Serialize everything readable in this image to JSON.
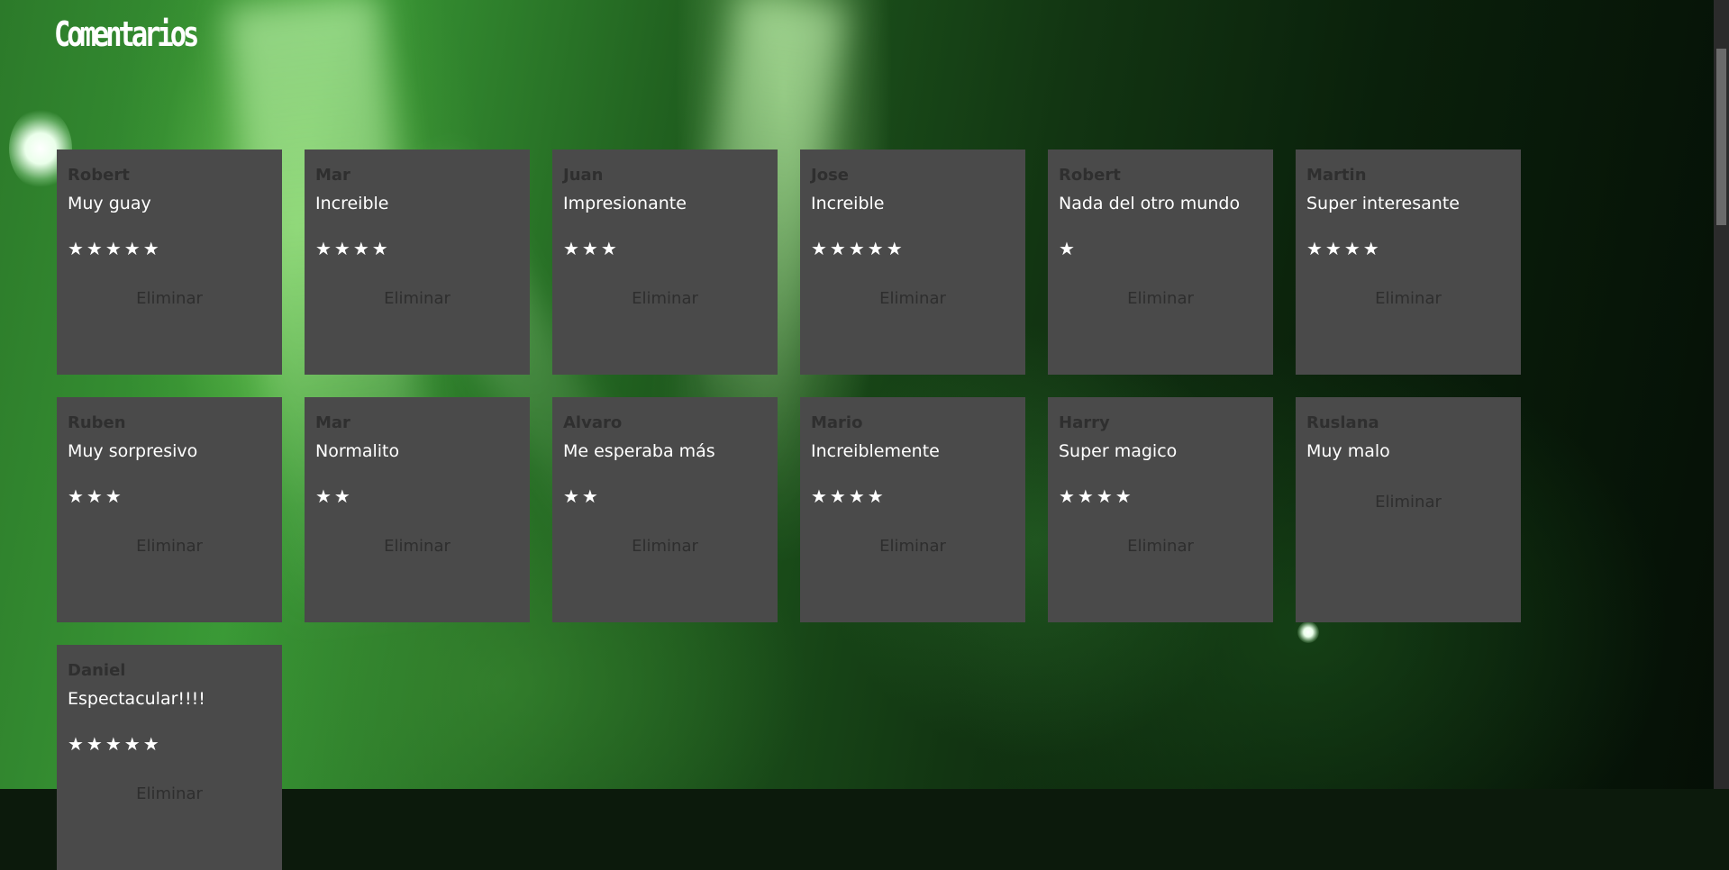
{
  "page": {
    "title": "Comentarios"
  },
  "delete_label": "Eliminar",
  "comments": [
    {
      "author": "Robert",
      "text": "Muy guay",
      "rating": 5,
      "stars": "★★★★★"
    },
    {
      "author": "Mar",
      "text": "Increible",
      "rating": 4,
      "stars": "★★★★"
    },
    {
      "author": "Juan",
      "text": "Impresionante",
      "rating": 3,
      "stars": "★★★"
    },
    {
      "author": "Jose",
      "text": "Increible",
      "rating": 5,
      "stars": "★★★★★"
    },
    {
      "author": "Robert",
      "text": "Nada del otro mundo",
      "rating": 1,
      "stars": "★"
    },
    {
      "author": "Martin",
      "text": "Super interesante",
      "rating": 4,
      "stars": "★★★★"
    },
    {
      "author": "Ruben",
      "text": "Muy sorpresivo",
      "rating": 3,
      "stars": "★★★"
    },
    {
      "author": "Mar",
      "text": "Normalito",
      "rating": 2,
      "stars": "★★"
    },
    {
      "author": "Alvaro",
      "text": "Me esperaba más",
      "rating": 2,
      "stars": "★★"
    },
    {
      "author": "Mario",
      "text": "Increiblemente",
      "rating": 4,
      "stars": "★★★★"
    },
    {
      "author": "Harry",
      "text": "Super magico",
      "rating": 4,
      "stars": "★★★★"
    },
    {
      "author": "Ruslana",
      "text": "Muy malo",
      "rating": 0,
      "stars": ""
    },
    {
      "author": "Daniel",
      "text": "Espectacular!!!!",
      "rating": 5,
      "stars": "★★★★★"
    }
  ]
}
